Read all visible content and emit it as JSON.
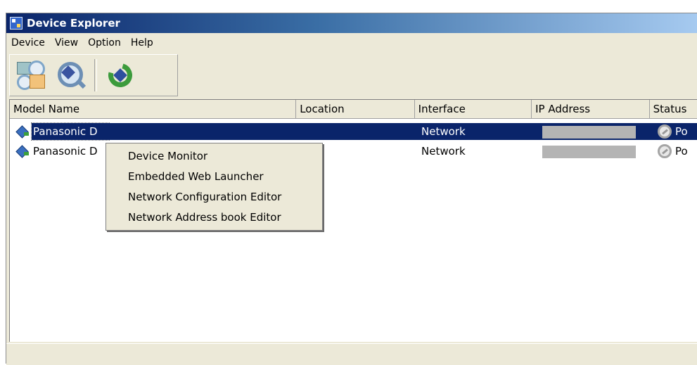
{
  "window": {
    "title": "Device Explorer"
  },
  "menubar": {
    "items": [
      "Device",
      "View",
      "Option",
      "Help"
    ]
  },
  "toolbar": {
    "buttons": [
      "device-tree-icon",
      "search-device-icon",
      "refresh-icon"
    ]
  },
  "list": {
    "columns": [
      "Model Name",
      "Location",
      "Interface",
      "IP Address",
      "Status"
    ],
    "rows": [
      {
        "model": "Panasonic D",
        "location": "",
        "interface": "Network",
        "ip": "",
        "status": "Po",
        "selected": true
      },
      {
        "model": "Panasonic D",
        "location": "",
        "interface": "Network",
        "ip": "",
        "status": "Po",
        "selected": false
      }
    ]
  },
  "context_menu": {
    "items": [
      "Device Monitor",
      "Embedded Web Launcher",
      "Network Configuration Editor",
      "Network Address book Editor"
    ]
  },
  "colors": {
    "selection": "#0a246a",
    "titlebar_start": "#0a246a",
    "titlebar_end": "#a6caf0"
  }
}
